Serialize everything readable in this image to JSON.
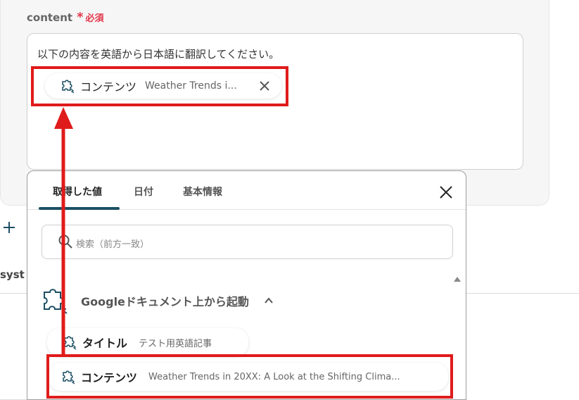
{
  "field": {
    "label": "content",
    "asterisk": "*",
    "required_text": "必須",
    "text": "以下の内容を英語から日本語に翻訳してください。"
  },
  "input_chip": {
    "name": "コンテンツ",
    "value": "Weather Trends i..."
  },
  "system_label": "syst",
  "popup": {
    "tabs": [
      {
        "label": "取得した値"
      },
      {
        "label": "日付"
      },
      {
        "label": "基本情報"
      }
    ],
    "search_placeholder": "検索（前方一致）",
    "section_title": "Googleドキュメント上から起動",
    "items": [
      {
        "name": "タイトル",
        "value": "テスト用英語記事"
      },
      {
        "name": "コンテンツ",
        "value": "Weather Trends in 20XX: A Look at the Shifting Clima..."
      }
    ]
  },
  "colors": {
    "accent": "#1c4f63",
    "required": "#e2374b",
    "highlight": "#e01b1b"
  },
  "icons": [
    "puzzle-icon",
    "close-icon",
    "search-icon",
    "chevron-up-icon",
    "plus-icon",
    "arrow-up-icon"
  ]
}
